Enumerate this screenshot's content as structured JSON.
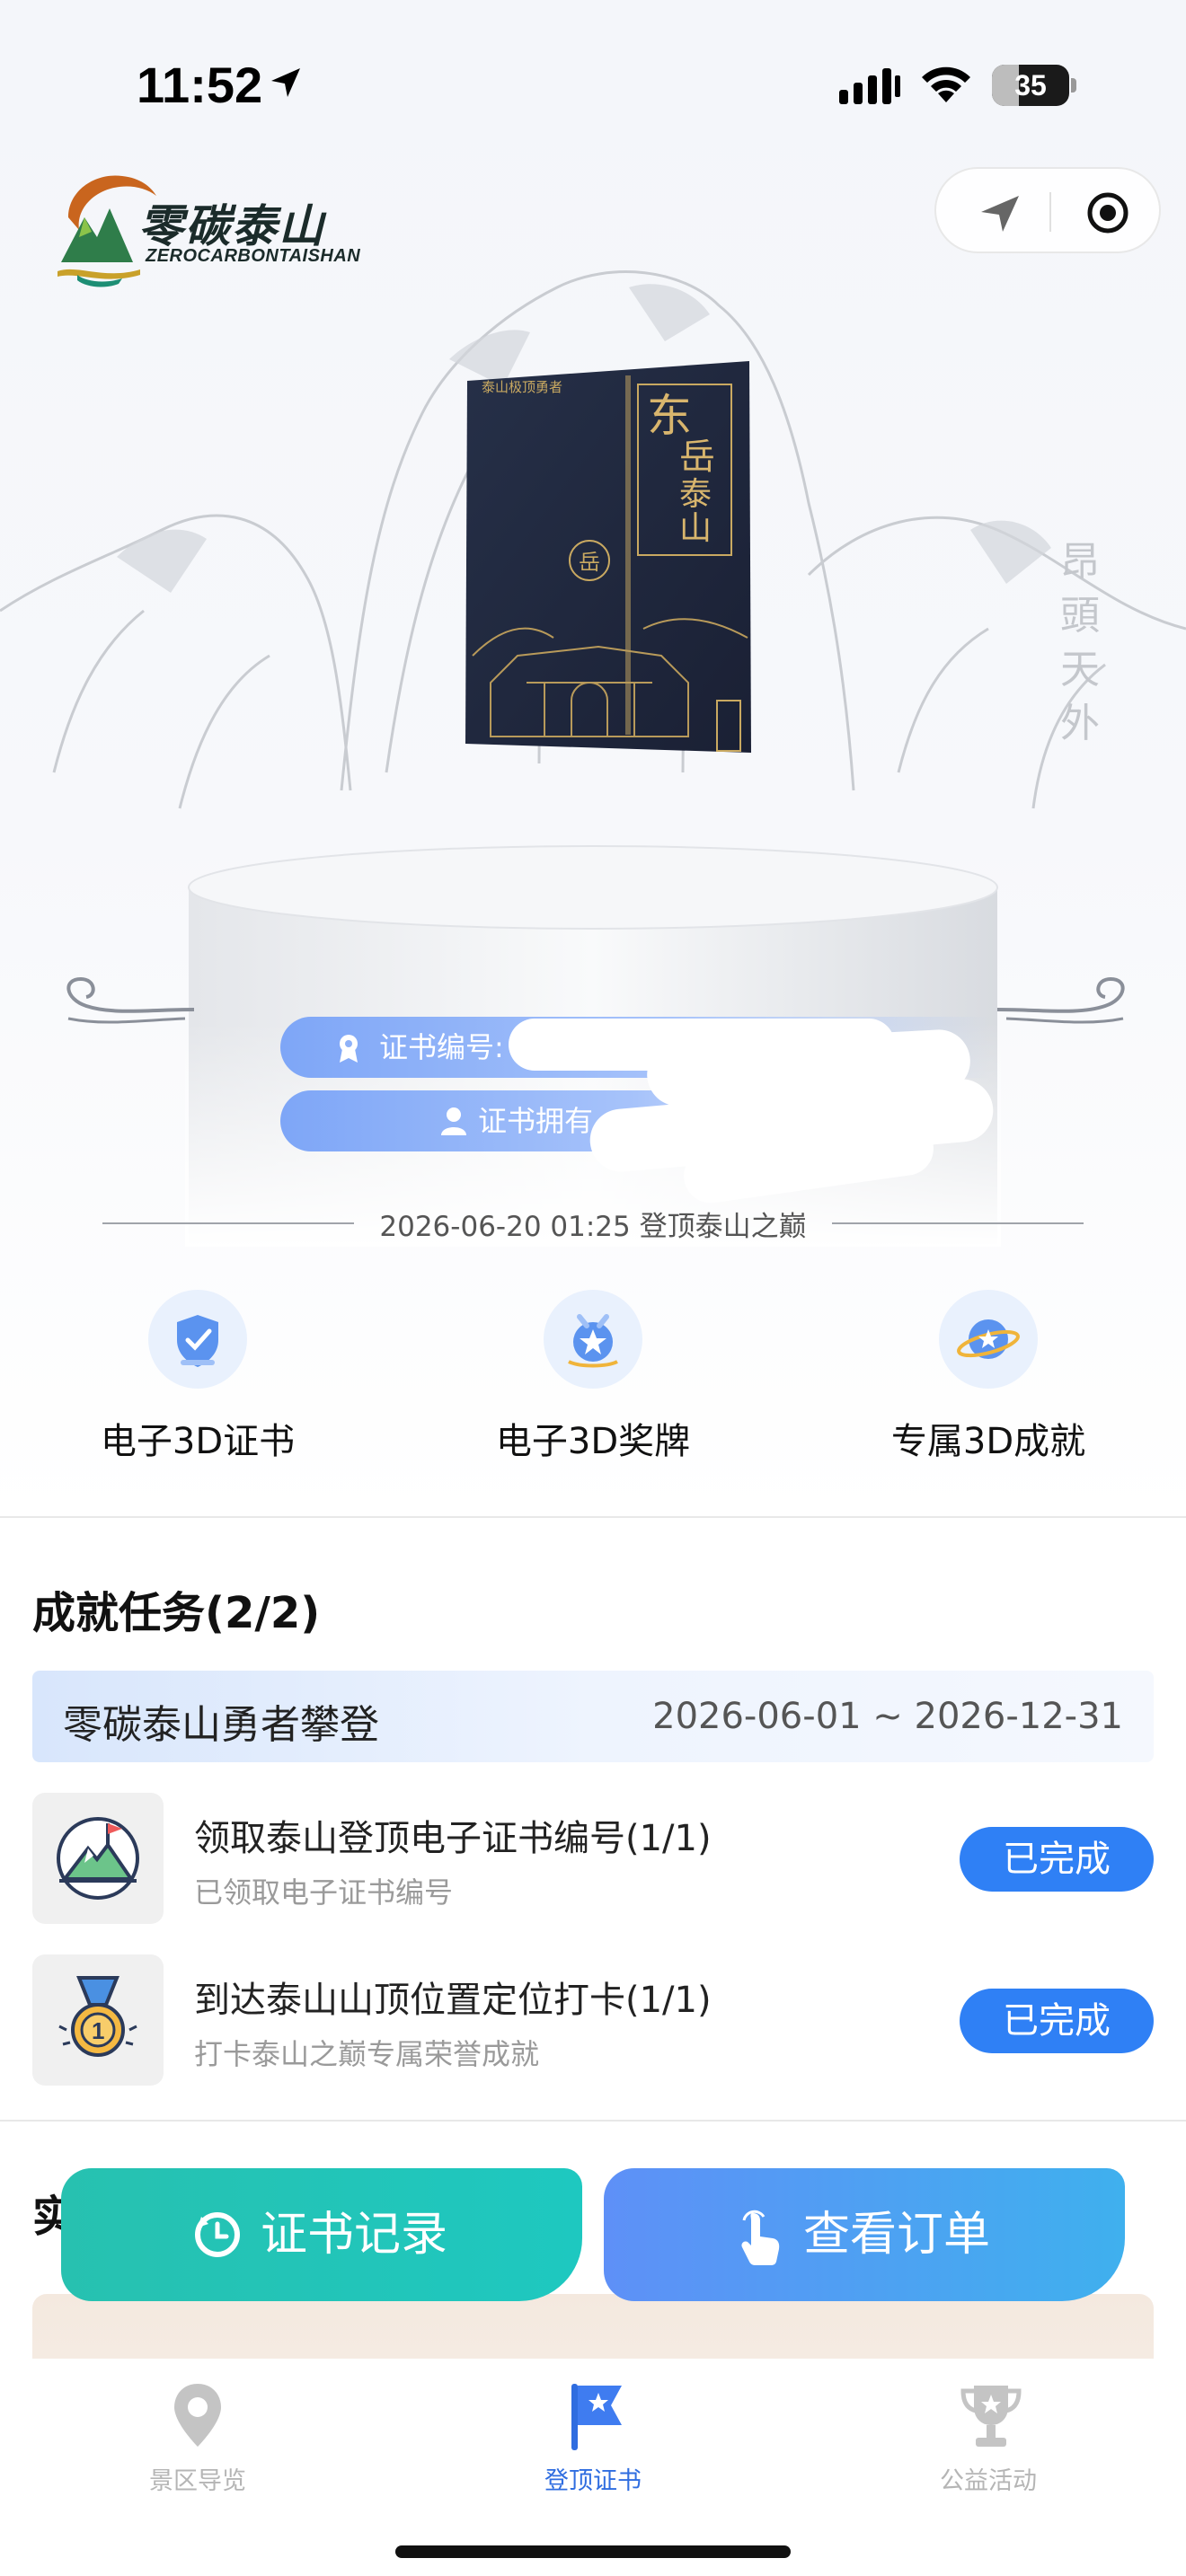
{
  "status_bar": {
    "time": "11:52",
    "battery": "35",
    "battery_level": 0.35
  },
  "header": {
    "logo_cn": "零碳泰山",
    "logo_en": "ZEROCARBONTAISHAN"
  },
  "certificate": {
    "number_label": "证书编号:",
    "owner_label": "证书拥有",
    "date_line": "2026-06-20 01:25 登顶泰山之巅"
  },
  "features": [
    {
      "label": "电子3D证书",
      "icon": "certificate-shield-icon"
    },
    {
      "label": "电子3D奖牌",
      "icon": "medal-star-icon"
    },
    {
      "label": "专属3D成就",
      "icon": "achievement-planet-icon"
    }
  ],
  "achievements": {
    "title": "成就任务(2/2)",
    "group_name": "零碳泰山勇者攀登",
    "group_dates": "2026-06-01 ~ 2026-12-31",
    "tasks": [
      {
        "title": "领取泰山登顶电子证书编号(1/1)",
        "subtitle": "已领取电子证书编号",
        "status": "已完成",
        "icon": "mountain-flag-icon"
      },
      {
        "title": "到达泰山山顶位置定位打卡(1/1)",
        "subtitle": "打卡泰山之巅专属荣誉成就",
        "status": "已完成",
        "icon": "gold-medal-icon"
      }
    ]
  },
  "partial_section_title": "实",
  "buttons": {
    "records": "证书记录",
    "orders": "查看订单"
  },
  "tabbar": {
    "items": [
      {
        "label": "景区导览",
        "icon": "map-pin-icon"
      },
      {
        "label": "登顶证书",
        "icon": "flag-star-icon"
      },
      {
        "label": "公益活动",
        "icon": "trophy-icon"
      }
    ]
  },
  "colors": {
    "accent_blue": "#2f80f5",
    "teal": "#1ec8c0",
    "tab_active": "#2f6de0"
  }
}
